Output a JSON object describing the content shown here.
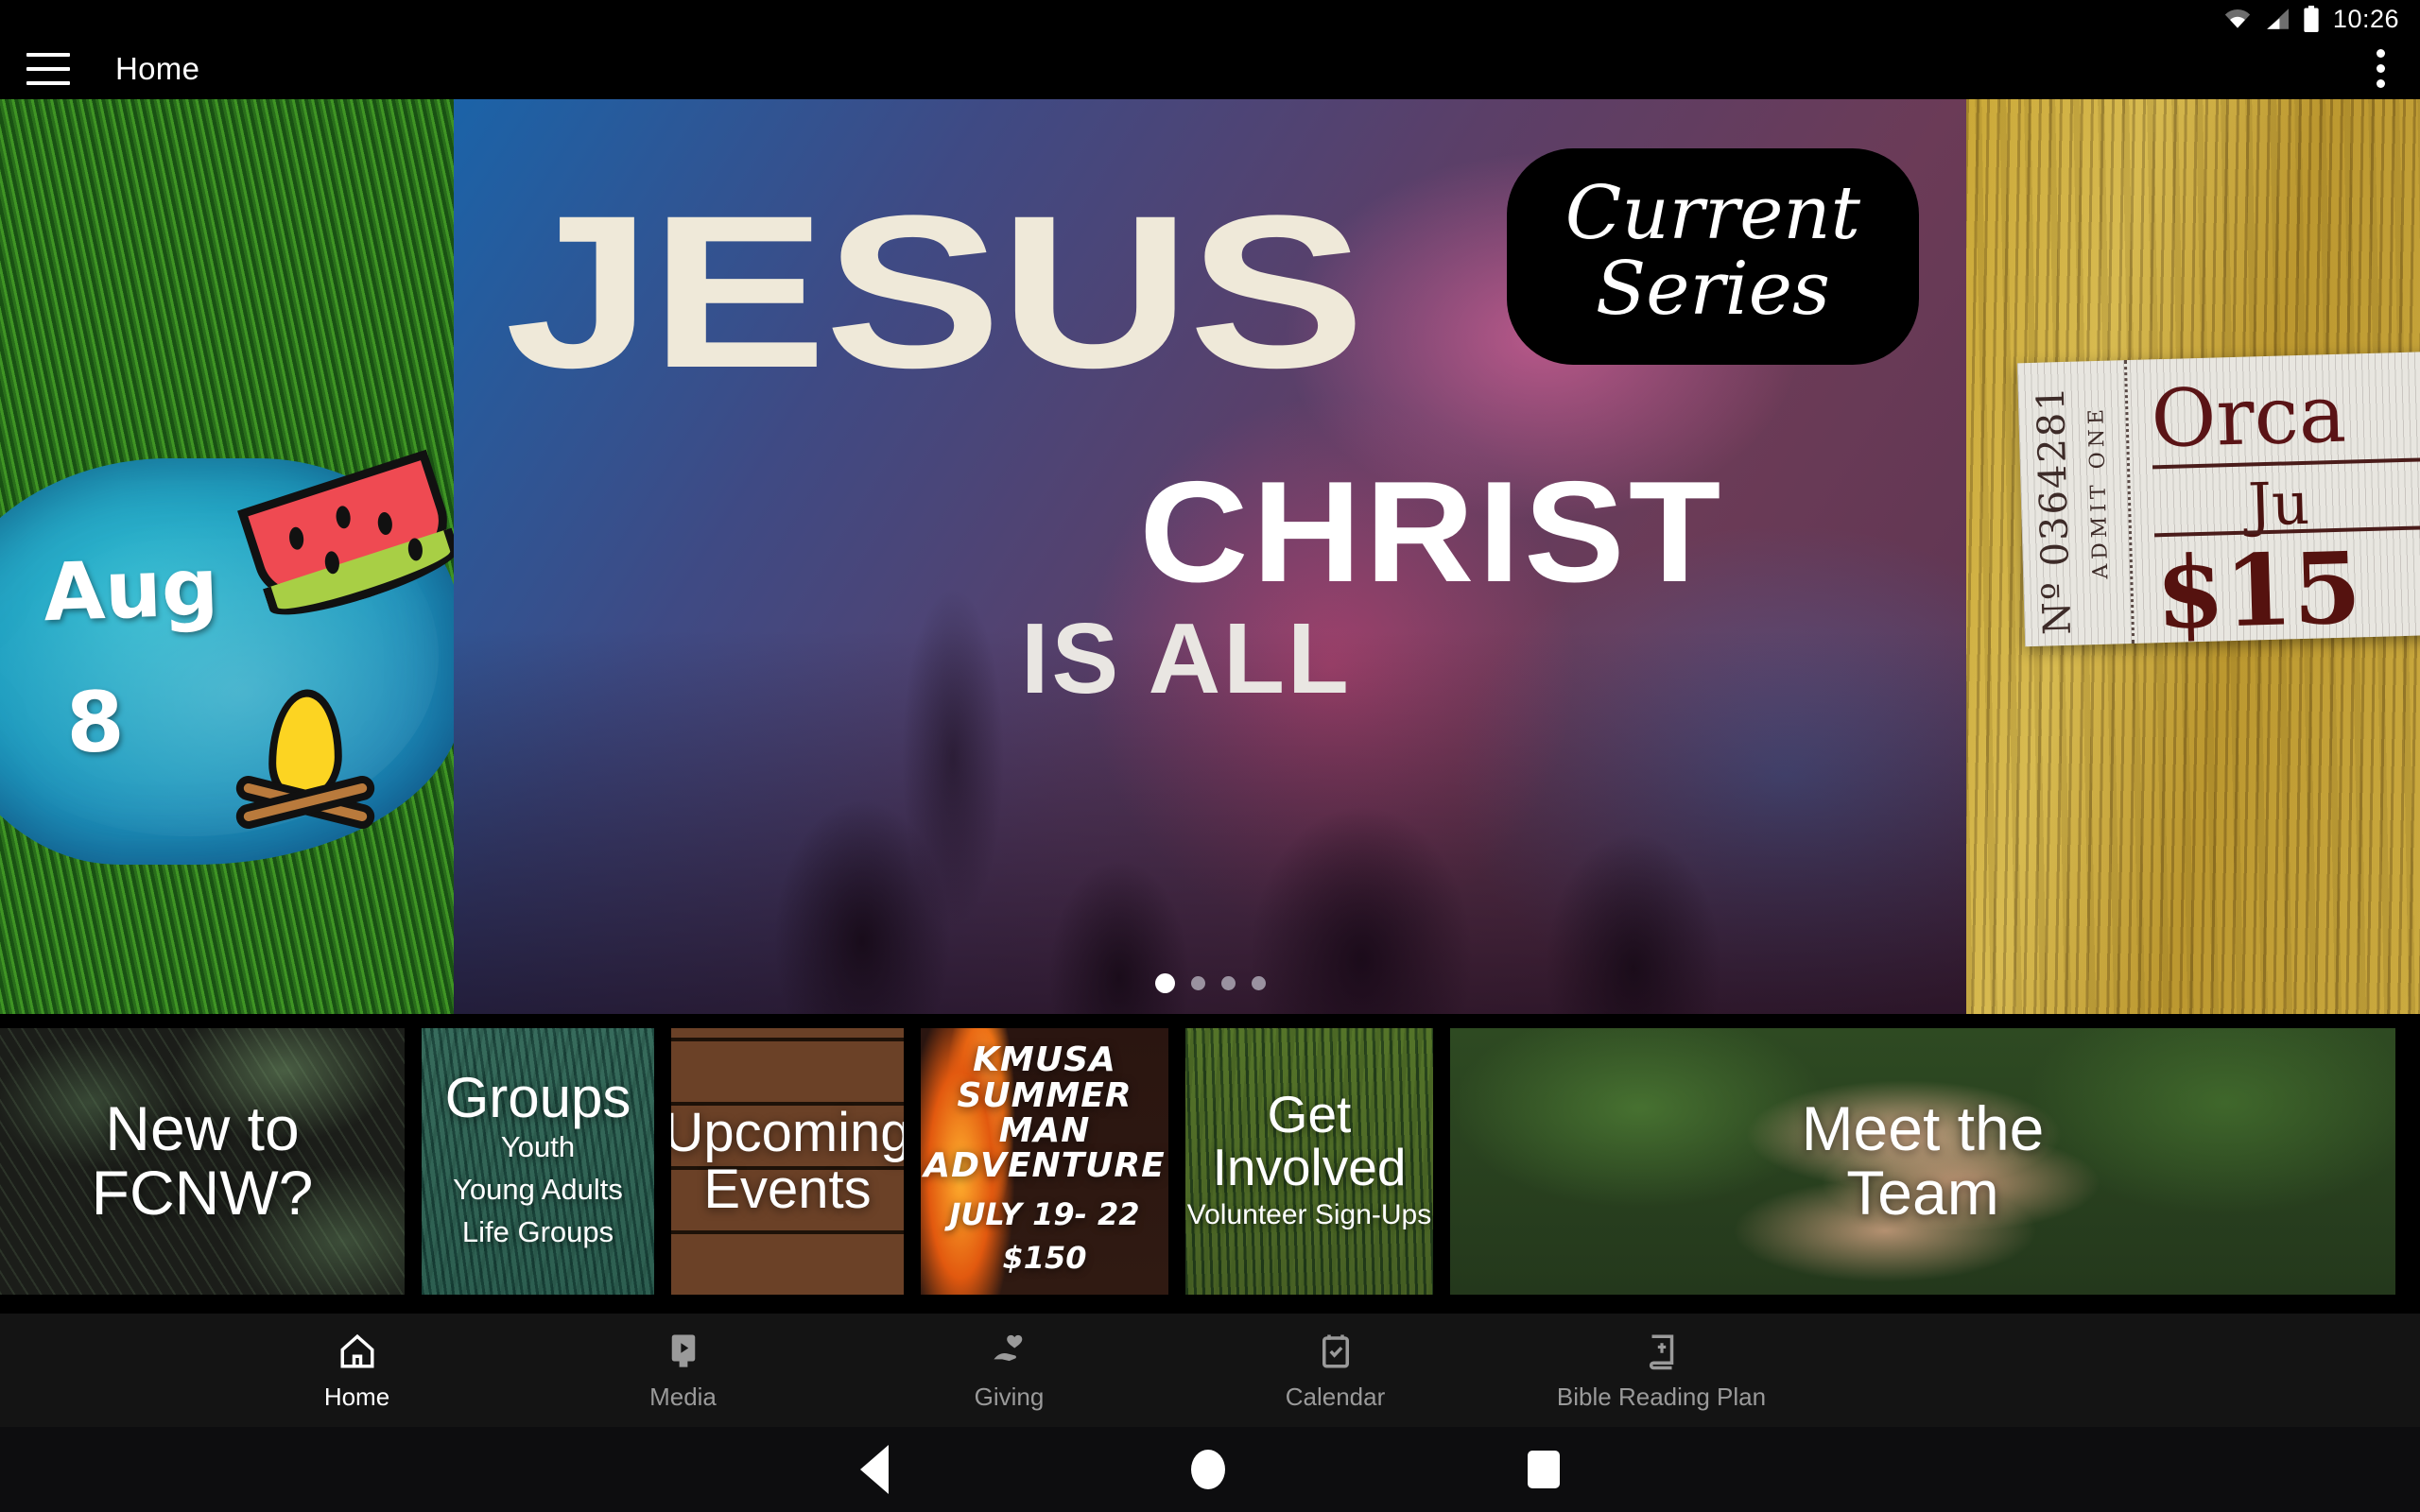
{
  "status_bar": {
    "time": "10:26",
    "icons": [
      "wifi-icon",
      "cellular-signal-icon",
      "battery-icon"
    ]
  },
  "app_bar": {
    "menu_icon": "hamburger-menu-icon",
    "title": "Home",
    "overflow_icon": "overflow-menu-icon"
  },
  "carousel": {
    "dot_count": 4,
    "active_dot": 1,
    "slides": {
      "previous": {
        "name": "summer-event-slide",
        "month": "Aug",
        "day": "8"
      },
      "current": {
        "name": "current-series-slide",
        "line1": "JESUS",
        "line2": "CHRIST",
        "line3": "IS ALL",
        "badge_line1": "Current",
        "badge_line2": "Series"
      },
      "next": {
        "name": "ticket-slide",
        "ticket_number": "Nº 0364281",
        "admit": "ADMIT ONE",
        "title": "Orca",
        "month": "Ju",
        "price": "$15"
      }
    }
  },
  "cards": [
    {
      "name": "new-to-fcnw-card",
      "title": "New to\nFCNW?",
      "subtitle": ""
    },
    {
      "name": "groups-card",
      "title": "Groups",
      "subtitle": "Youth\nYoung Adults\nLife Groups"
    },
    {
      "name": "upcoming-events-card",
      "title": "Upcoming\nEvents",
      "subtitle": ""
    },
    {
      "name": "kmusa-card",
      "title": "KMUSA SUMMER\nMAN ADVENTURE",
      "subtitle": "JULY 19- 22\n$150"
    },
    {
      "name": "get-involved-card",
      "title": "Get Involved",
      "subtitle": "Volunteer Sign-Ups"
    },
    {
      "name": "meet-the-team-card",
      "title": "Meet the\nTeam",
      "subtitle": ""
    }
  ],
  "tab_bar": {
    "active_index": 0,
    "tabs": [
      {
        "label": "Home",
        "icon": "home-icon"
      },
      {
        "label": "Media",
        "icon": "media-play-icon"
      },
      {
        "label": "Giving",
        "icon": "giving-hand-heart-icon"
      },
      {
        "label": "Calendar",
        "icon": "calendar-check-icon"
      },
      {
        "label": "Bible Reading Plan",
        "icon": "bible-book-icon"
      }
    ]
  },
  "system_nav": {
    "back": "back-triangle-icon",
    "home": "home-circle-icon",
    "recents": "recents-square-icon"
  },
  "colors": {
    "app_bar_bg": "#000000",
    "tab_bar_bg": "#141414",
    "tab_active": "#ffffff",
    "tab_inactive": "#9a9a9a"
  }
}
